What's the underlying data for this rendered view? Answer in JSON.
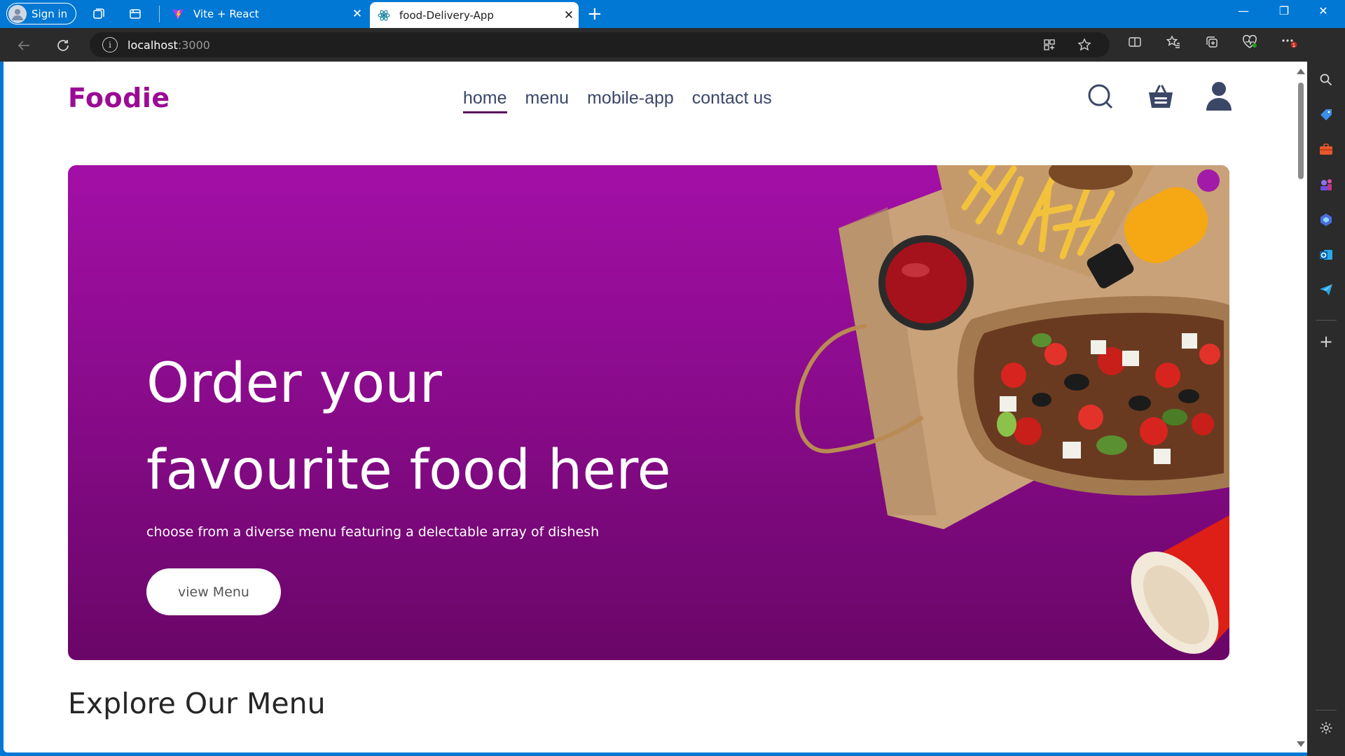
{
  "browser": {
    "signin_label": "Sign in",
    "tabs": [
      {
        "title": "Vite + React",
        "active": false
      },
      {
        "title": "food-Delivery-App",
        "active": true
      }
    ],
    "url_host": "localhost",
    "url_port": ":3000",
    "accent": "#0078d4"
  },
  "site": {
    "logo": "Foodie",
    "nav": [
      "home",
      "menu",
      "mobile-app",
      "contact us"
    ],
    "active_nav": "home",
    "brand_color": "#9b0b93"
  },
  "hero": {
    "title_line1": "Order your",
    "title_line2": "favourite food here",
    "subtitle": "choose from a diverse menu featuring a delectable array of dishesh",
    "button_label": "view Menu"
  },
  "explore": {
    "title": "Explore Our Menu"
  }
}
